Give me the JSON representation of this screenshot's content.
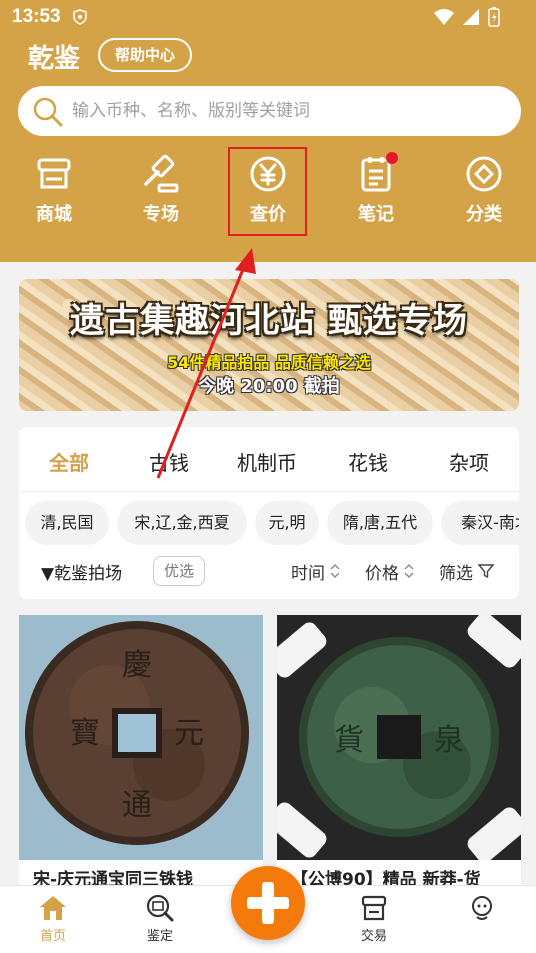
{
  "status_bar": {
    "time": "13:53"
  },
  "header": {
    "app_title": "乾鉴",
    "help_label": "帮助中心"
  },
  "search": {
    "placeholder": "输入币种、名称、版别等关键词"
  },
  "nav": {
    "items": [
      {
        "label": "商城",
        "icon": "shop-icon"
      },
      {
        "label": "专场",
        "icon": "gavel-icon"
      },
      {
        "label": "查价",
        "icon": "yen-coin-icon"
      },
      {
        "label": "笔记",
        "icon": "notepad-icon",
        "badge": "red-dot"
      },
      {
        "label": "分类",
        "icon": "category-diamond-icon"
      }
    ]
  },
  "banner": {
    "title": "遗古集趣河北站 甄选专场",
    "subtitle": "54件精品拍品 品质信赖之选",
    "subtitle2": "今晚 20:00 截拍"
  },
  "category_tabs": [
    "全部",
    "古钱",
    "机制币",
    "花钱",
    "杂项"
  ],
  "era_chips": [
    "清,民国",
    "宋,辽,金,西夏",
    "元,明",
    "隋,唐,五代",
    "秦汉-南北"
  ],
  "sort_bar": {
    "left_label": "▼乾鉴拍场",
    "badge": "优选",
    "time_label": "时间",
    "price_label": "价格",
    "filter_label": "筛选"
  },
  "products": [
    {
      "title": "宋-庆元通宝同三铢钱"
    },
    {
      "title": "【公博90】精品 新莽-货"
    }
  ],
  "tab_bar": {
    "items": [
      {
        "label": "首页",
        "icon": "home-icon"
      },
      {
        "label": "鉴定",
        "icon": "appraise-magnifier-icon"
      },
      {
        "label": "",
        "icon": "plus-icon"
      },
      {
        "label": "交易",
        "icon": "trade-icon"
      },
      {
        "label": "",
        "icon": "service-icon"
      }
    ]
  },
  "colors": {
    "brand": "#d4a247",
    "fab": "#f57a0c",
    "highlight": "#e02020"
  }
}
